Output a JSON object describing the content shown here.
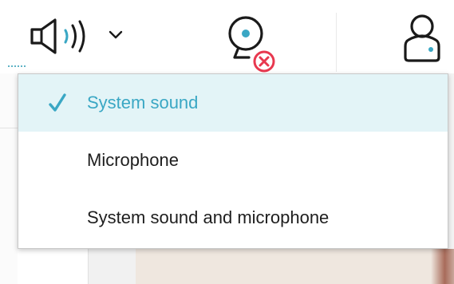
{
  "toolbar": {
    "audio_button": {
      "icon": "speaker-icon",
      "dropdown_icon": "chevron-down-icon"
    },
    "camera_button": {
      "icon": "webcam-icon",
      "status_icon": "error-x-icon",
      "status_color": "#e8384f"
    },
    "user_button": {
      "icon": "user-icon"
    }
  },
  "audio_menu": {
    "items": [
      {
        "label": "System sound",
        "selected": true,
        "icon": "checkmark-icon"
      },
      {
        "label": "Microphone",
        "selected": false
      },
      {
        "label": "System sound and microphone",
        "selected": false
      }
    ]
  },
  "colors": {
    "accent": "#3aa7c4",
    "selected_bg": "#e3f4f7",
    "icon_stroke": "#1a1a1a",
    "error": "#e8384f"
  }
}
